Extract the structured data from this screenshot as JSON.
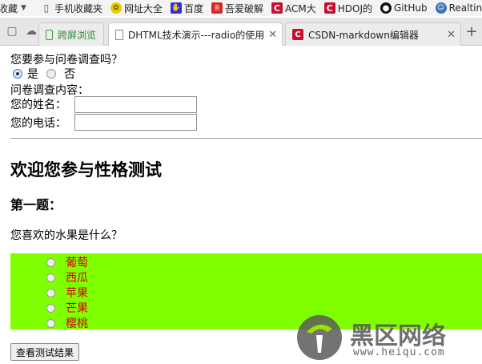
{
  "bookmarks": {
    "items": [
      {
        "label": "收藏",
        "icon": "none"
      },
      {
        "label": "手机收藏夹",
        "icon": "phone-icon"
      },
      {
        "label": "网址大全",
        "icon": "web-directory-icon"
      },
      {
        "label": "百度",
        "icon": "baidu-paw-icon"
      },
      {
        "label": "吾爱破解",
        "icon": "52pojie-icon"
      },
      {
        "label": "ACM大",
        "icon": "csdn-c-icon"
      },
      {
        "label": "HDOJ的",
        "icon": "csdn-c-icon"
      },
      {
        "label": "GitHub",
        "icon": "github-icon"
      },
      {
        "label": "Realtin",
        "icon": "realtime-icon"
      }
    ]
  },
  "tabs": [
    {
      "label": "跨屏浏览",
      "icon": "phone-icon",
      "active": false
    },
    {
      "label": "DHTML技术演示---radio的使用",
      "icon": "page-icon",
      "active": true
    },
    {
      "label": "CSDN-markdown编辑器",
      "icon": "csdn-c-icon",
      "active": false
    }
  ],
  "survey": {
    "question": "您要参与问卷调查吗？",
    "yes_label": "是",
    "no_label": "否",
    "content_label": "问卷调查内容：",
    "name_label": "您的姓名：",
    "phone_label": "您的电话：",
    "name_value": "",
    "phone_value": ""
  },
  "test": {
    "title": "欢迎您参与性格测试",
    "question_heading": "第一题：",
    "question_text": "您喜欢的水果是什么？",
    "options": [
      "葡萄",
      "西瓜",
      "苹果",
      "芒果",
      "樱桃"
    ],
    "submit_label": "查看测试结果"
  },
  "watermark": {
    "logo_text": "黑区网络",
    "url": "www.heiqu.com"
  },
  "colors": {
    "fruit_box_bg": "#80ff00",
    "fruit_text": "#d40000",
    "csdn_red": "#c8102e"
  }
}
